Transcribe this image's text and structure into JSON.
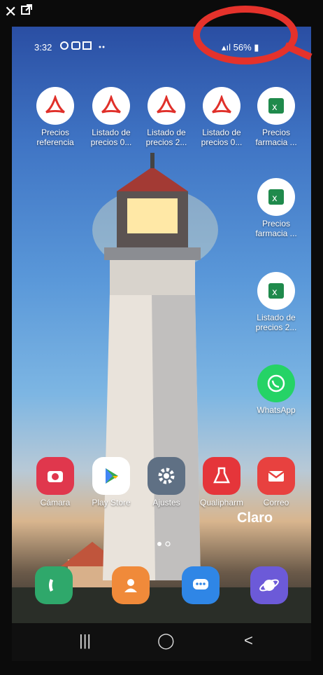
{
  "status": {
    "time": "3:32",
    "battery": "56%"
  },
  "apps": [
    {
      "label": "Precios referencia",
      "type": "pdf"
    },
    {
      "label": "Listado de precios 0...",
      "type": "pdf"
    },
    {
      "label": "Listado de precios 2...",
      "type": "pdf"
    },
    {
      "label": "Listado de precios 0...",
      "type": "pdf"
    },
    {
      "label": "Precios farmacia ...",
      "type": "xls"
    },
    {
      "label": "Precios farmacia ...",
      "type": "xls"
    },
    {
      "label": "Listado de precios 2...",
      "type": "xls"
    },
    {
      "label": "WhatsApp",
      "type": "whatsapp"
    }
  ],
  "dock_row": [
    {
      "label": "Cámara",
      "icon": "camera-icon",
      "color": "#e0374d"
    },
    {
      "label": "Play Store",
      "icon": "play-store-icon",
      "color": "#ffffff"
    },
    {
      "label": "Ajustes",
      "icon": "settings-gear-icon",
      "color": "#5f7084"
    },
    {
      "label": "Qualipharm",
      "icon": "flask-icon",
      "color": "#e5353a"
    },
    {
      "label": "Correo",
      "icon": "mail-icon",
      "color": "#e8413f"
    }
  ],
  "brand": "Claro",
  "bottom_dock": [
    {
      "icon": "phone-icon",
      "color": "#2fa86b"
    },
    {
      "icon": "contacts-icon",
      "color": "#f08a3a"
    },
    {
      "icon": "messages-icon",
      "color": "#2f86e6"
    },
    {
      "icon": "internet-browser-icon",
      "color": "#6c5ad8"
    }
  ],
  "nav": {
    "recent": "|||",
    "home": "◯",
    "back": "<"
  }
}
